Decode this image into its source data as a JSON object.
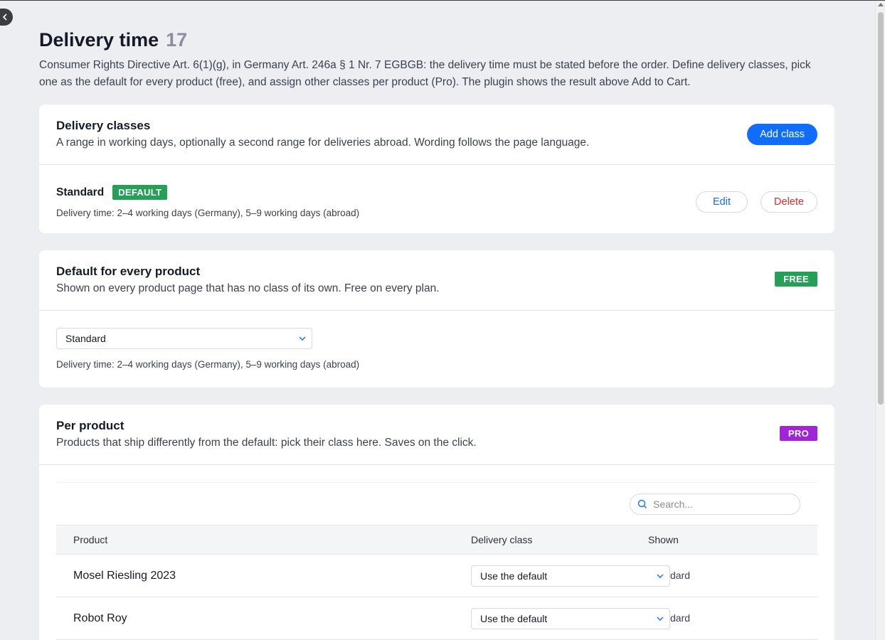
{
  "header": {
    "title": "Delivery time",
    "count": "17",
    "intro": "Consumer Rights Directive Art. 6(1)(g), in Germany Art. 246a § 1 Nr. 7 EGBGB: the delivery time must be stated before the order. Define delivery classes, pick one as the default for every product (free), and assign other classes per product (Pro). The plugin shows the result above Add to Cart."
  },
  "delivery_classes": {
    "title": "Delivery classes",
    "subtitle": "A range in working days, optionally a second range for deliveries abroad. Wording follows the page language.",
    "add_label": "Add class",
    "items": [
      {
        "name": "Standard",
        "badge": "DEFAULT",
        "description": "Delivery time: 2–4 working days (Germany), 5–9 working days (abroad)",
        "edit_label": "Edit",
        "delete_label": "Delete"
      }
    ]
  },
  "default_product": {
    "title": "Default for every product",
    "subtitle": "Shown on every product page that has no class of its own. Free on every plan.",
    "badge": "FREE",
    "select_value": "Standard",
    "description": "Delivery time: 2–4 working days (Germany), 5–9 working days (abroad)"
  },
  "per_product": {
    "title": "Per product",
    "subtitle": "Products that ship differently from the default: pick their class here. Saves on the click.",
    "badge": "PRO",
    "search_placeholder": "Search...",
    "columns": [
      "Product",
      "Delivery class",
      "Shown"
    ],
    "rows": [
      {
        "product": "Mosel Riesling 2023",
        "delivery_class": "Use the default",
        "shown": "dard"
      },
      {
        "product": "Robot Roy",
        "delivery_class": "Use the default",
        "shown": "dard"
      }
    ]
  },
  "colors": {
    "accent": "#116dff",
    "success": "#25a056",
    "pro": "#a124d8",
    "danger": "#e02d2d",
    "background": "#eceef2"
  },
  "icons": [
    "chevron-left-icon",
    "chevron-down-icon",
    "search-icon"
  ]
}
